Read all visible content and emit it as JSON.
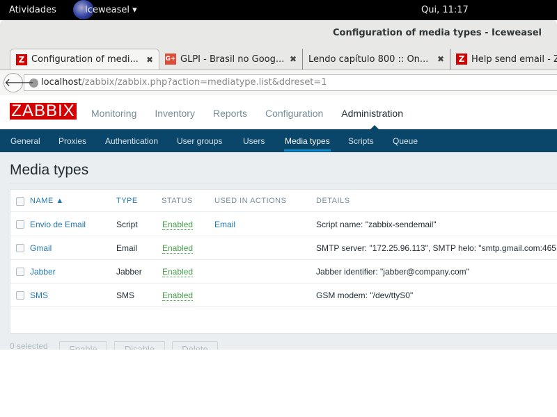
{
  "system": {
    "activities": "Atividades",
    "app": "Iceweasel",
    "clock": "Qui, 11:17"
  },
  "window": {
    "title": "Configuration of media types - Iceweasel"
  },
  "tabs": [
    {
      "label": "Configuration of medi...",
      "favicon": "Z"
    },
    {
      "label": "GLPI - Brasil no Goog...",
      "favicon": "G+"
    },
    {
      "label": "Lendo capítulo 800 :: On..."
    },
    {
      "label": "Help send email - Z",
      "favicon": "Z"
    }
  ],
  "url": {
    "host": "localhost",
    "path": "/zabbix/zabbix.php?action=mediatype.list&ddreset=1"
  },
  "logo": "ZABBIX",
  "mainnav": [
    "Monitoring",
    "Inventory",
    "Reports",
    "Configuration",
    "Administration"
  ],
  "subnav": [
    "General",
    "Proxies",
    "Authentication",
    "User groups",
    "Users",
    "Media types",
    "Scripts",
    "Queue"
  ],
  "page_title": "Media types",
  "table": {
    "headers": {
      "name": "NAME ▲",
      "type": "TYPE",
      "status": "STATUS",
      "used": "USED IN ACTIONS",
      "details": "DETAILS"
    },
    "rows": [
      {
        "name": "Envio de Email",
        "type": "Script",
        "status": "Enabled",
        "used": "Email",
        "details": "Script name: \"zabbix-sendemail\""
      },
      {
        "name": "Gmail",
        "type": "Email",
        "status": "Enabled",
        "used": "",
        "details": "SMTP server: \"172.25.96.113\", SMTP helo: \"smtp.gmail.com:465"
      },
      {
        "name": "Jabber",
        "type": "Jabber",
        "status": "Enabled",
        "used": "",
        "details": "Jabber identifier: \"jabber@company.com\""
      },
      {
        "name": "SMS",
        "type": "SMS",
        "status": "Enabled",
        "used": "",
        "details": "GSM modem: \"/dev/ttyS0\""
      }
    ]
  },
  "footer": {
    "selected": "0 selected",
    "enable": "Enable",
    "disable": "Disable",
    "delete": "Delete"
  }
}
